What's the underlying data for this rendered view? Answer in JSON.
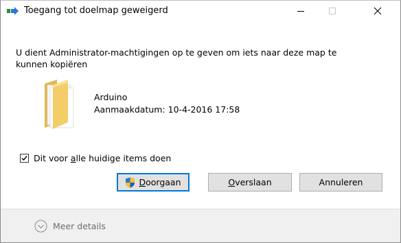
{
  "titlebar": {
    "title": "Toegang tot doelmap geweigerd"
  },
  "message": {
    "line1": "U dient Administrator-machtigingen op te geven om iets naar deze map te",
    "line2": "kunnen kopiëren"
  },
  "item": {
    "icon": "folder-icon",
    "name": "Arduino",
    "created": "Aanmaakdatum: 10-4-2016 17:58"
  },
  "checkbox": {
    "checked": true,
    "label_before": "Dit voor ",
    "label_accel": "a",
    "label_after": "lle huidige items doen"
  },
  "buttons": {
    "continue": {
      "accel": "D",
      "rest": "oorgaan",
      "icon": "uac-shield-icon"
    },
    "skip": {
      "accel": "O",
      "rest": "verslaan"
    },
    "cancel": {
      "label": "Annuleren"
    }
  },
  "footer": {
    "details_label": "Meer details"
  },
  "colors": {
    "accent": "#0078d7",
    "footer_bg": "#f0f0f0",
    "button_bg": "#e1e1e1",
    "muted_text": "#6d6d6d"
  }
}
